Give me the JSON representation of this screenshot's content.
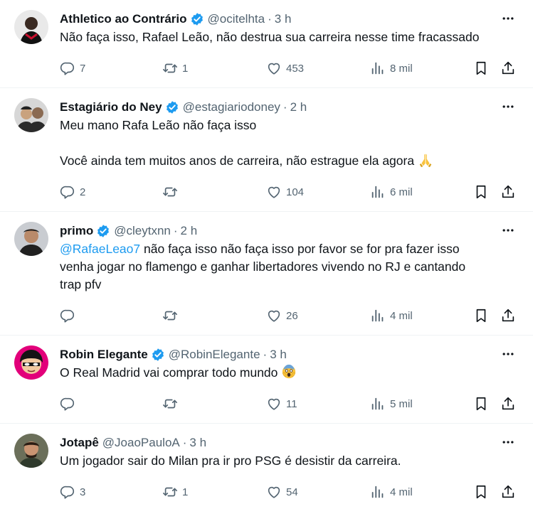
{
  "tweets": [
    {
      "name": "Athletico ao Contrário",
      "handle": "@ocitelhta",
      "time": "3 h",
      "lines": [
        "Não faça isso, Rafael Leão, não destrua sua carreira nesse time fracassado"
      ],
      "replies": "7",
      "retweets": "1",
      "likes": "453",
      "views": "8 mil"
    },
    {
      "name": "Estagiário do Ney",
      "handle": "@estagiariodoney",
      "time": "2 h",
      "line1": "Meu mano Rafa Leão não faça isso",
      "line2": "Você ainda tem muitos anos de carreira, não estrague ela agora",
      "replies": "2",
      "retweets": "",
      "likes": "104",
      "views": "6 mil"
    },
    {
      "name": "primo",
      "handle": "@cleytxnn",
      "time": "2 h",
      "mention": "@RafaeLeao7",
      "line1_rest": " não faça isso não faça isso por favor se for pra fazer isso",
      "line2": "venha jogar no flamengo e ganhar libertadores vivendo no RJ e cantando",
      "line3": "trap pfv",
      "replies": "",
      "retweets": "",
      "likes": "26",
      "views": "4 mil"
    },
    {
      "name": "Robin Elegante",
      "handle": "@RobinElegante",
      "time": "3 h",
      "line1": "O Real Madrid vai comprar todo mundo",
      "replies": "",
      "retweets": "",
      "likes": "11",
      "views": "5 mil"
    },
    {
      "name": "Jotapê",
      "handle": "@JoaoPauloA",
      "time": "3 h",
      "line1": "Um jogador sair do Milan pra ir pro PSG é desistir da carreira.",
      "replies": "3",
      "retweets": "1",
      "likes": "54",
      "views": "4 mil"
    }
  ],
  "separator": "·",
  "colors": {
    "verified": "#1d9bf0",
    "secondary_text": "#536471",
    "mention": "#1d9bf0",
    "divider": "#eff3f4"
  },
  "icons": [
    "reply-icon",
    "retweet-icon",
    "like-icon",
    "views-icon",
    "bookmark-icon",
    "share-icon",
    "more-icon",
    "verified-badge-icon"
  ]
}
